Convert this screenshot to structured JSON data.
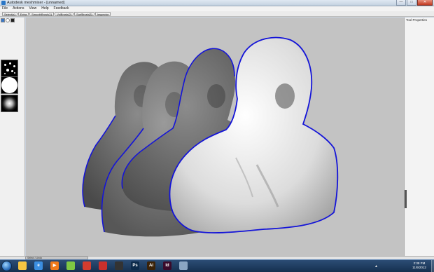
{
  "window": {
    "title": "Autodesk meshmixer - [unnamed]",
    "controls": {
      "minimize": "—",
      "maximize": "□",
      "close": "✕"
    }
  },
  "menubar": {
    "items": [
      "File",
      "Actions",
      "View",
      "Help",
      "Feedback"
    ]
  },
  "toolbar": {
    "buttons": [
      "Select(s)",
      "Extra",
      "SmoothBrush(1)",
      "VolBrush(2)",
      "SurfBrush(3)",
      "Inspector"
    ]
  },
  "left_panel": {
    "mode_icons": [
      "mesh-mode-icon",
      "sphere-mode-icon",
      "square-mode-icon"
    ],
    "brushes": [
      "dots-brush-icon",
      "disc-brush-icon",
      "soft-brush-icon"
    ]
  },
  "right_panel": {
    "title": "Tool Properties"
  },
  "viewport": {
    "scene": "four sculpted head-and-torso meshes with blue boundary outlines",
    "colors": {
      "background": "#c3c3c3",
      "outline": "#1414d8",
      "mesh_dark": "#6e6e6e",
      "mesh_light": "#e8e8e8"
    }
  },
  "status": {
    "tab_label": "Select / Undo"
  },
  "taskbar": {
    "pinned": [
      {
        "name": "explorer-icon",
        "color": "#f5c542",
        "glyph": ""
      },
      {
        "name": "ie-icon",
        "color": "#3b8ee0",
        "glyph": "e"
      },
      {
        "name": "media-player-icon",
        "color": "#f07a1a",
        "glyph": "▶"
      },
      {
        "name": "spotify-icon",
        "color": "#7fc843",
        "glyph": ""
      },
      {
        "name": "chrome-icon",
        "color": "#d33c2f",
        "glyph": ""
      },
      {
        "name": "mail-icon",
        "color": "#c9302c",
        "glyph": ""
      },
      {
        "name": "steam-icon",
        "color": "#333333",
        "glyph": ""
      },
      {
        "name": "photoshop-icon",
        "color": "#0c2a4a",
        "glyph": "Ps"
      },
      {
        "name": "illustrator-icon",
        "color": "#3a2208",
        "glyph": "Ai"
      },
      {
        "name": "indesign-icon",
        "color": "#3a0a2a",
        "glyph": "Id"
      },
      {
        "name": "meshmixer-icon",
        "color": "#8aa6c4",
        "glyph": ""
      }
    ],
    "clock_time": "2:38 PM",
    "clock_date": "11/9/2012"
  }
}
